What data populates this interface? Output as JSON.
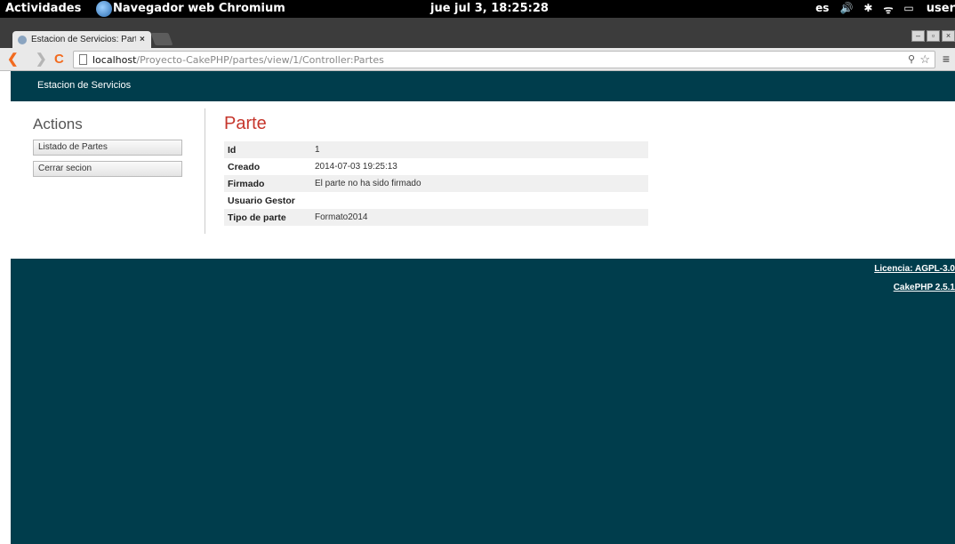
{
  "topbar": {
    "activities": "Actividades",
    "app_name": "Navegador web Chromium",
    "clock": "jue jul  3, 18:25:28",
    "lang": "es",
    "volume_icon": "🔊",
    "bluetooth_icon": "✱",
    "wifi_icon": "ᯤ",
    "battery_icon": "▭",
    "user": "user"
  },
  "browser": {
    "tab_title": "Estacion de Servicios: Partes",
    "tab_close": "×",
    "url_host": "localhost",
    "url_path": "/Proyecto-CakePHP/partes/view/1/Controller:Partes",
    "back": "❮",
    "forward": "❯",
    "reload": "C",
    "zoom_icon": "⚲",
    "star_icon": "☆",
    "menu_icon": "≡",
    "win_min": "–",
    "win_max": "▫",
    "win_close": "×"
  },
  "page": {
    "site_name": "Estacion de Servicios",
    "actions_title": "Actions",
    "actions": [
      "Listado de Partes",
      "Cerrar secion"
    ],
    "view_title": "Parte",
    "fields": [
      {
        "label": "Id",
        "value": "1"
      },
      {
        "label": "Creado",
        "value": "2014-07-03 19:25:13"
      },
      {
        "label": "Firmado",
        "value": "El parte no ha sido firmado"
      },
      {
        "label": "Usuario Gestor",
        "value": ""
      },
      {
        "label": "Tipo de parte",
        "value": "Formato2014"
      }
    ],
    "footer_license": "Licencia: AGPL-3.0",
    "footer_cake": "CakePHP 2.5.1"
  }
}
